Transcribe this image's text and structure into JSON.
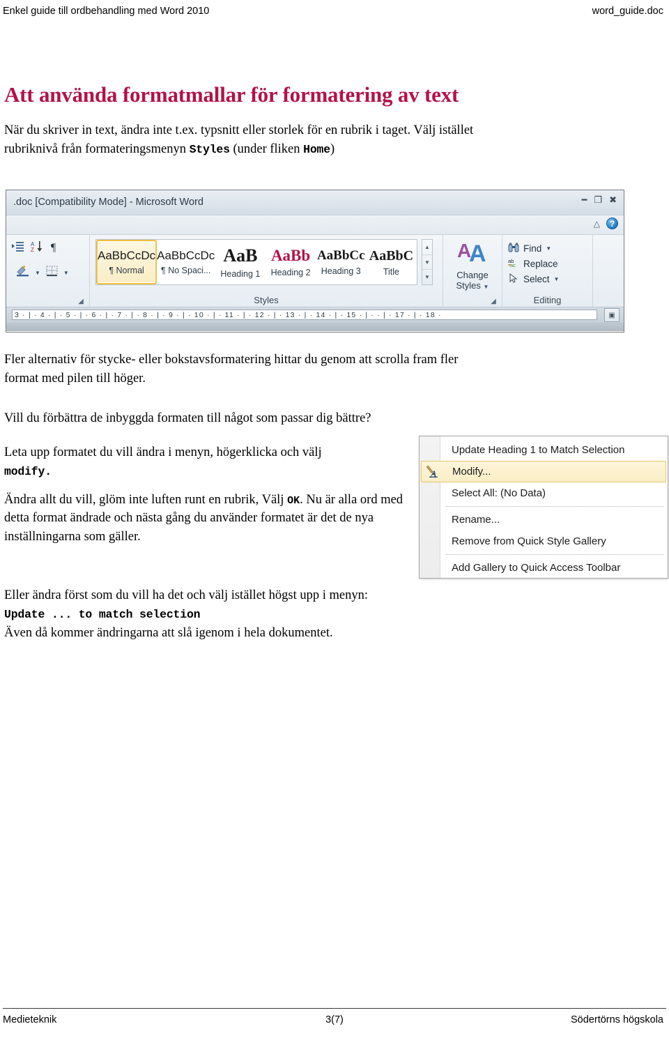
{
  "header": {
    "left": "Enkel guide till ordbehandling med Word 2010",
    "right": "word_guide.doc"
  },
  "main": {
    "title": "Att använda formatmallar för formatering av text",
    "intro_line1": "När du skriver in text, ändra inte t.ex. typsnitt eller storlek för en rubrik i taget. Välj istället",
    "intro_line2_a": "rubriknivå från formateringsmenyn ",
    "intro_line2_code": "Styles",
    "intro_line2_b": " (under fliken ",
    "intro_line2_code2": "Home",
    "intro_line2_c": ")",
    "para_scroll": "Fler alternativ för stycke- eller bokstavsformatering hittar du genom att scrolla fram fler format med pilen till höger.",
    "para_improve": "Vill du förbättra de inbyggda formaten till något som passar dig bättre?",
    "para_find_a": "Leta upp formatet du vill ändra i menyn, högerklicka och välj",
    "para_find_code": "modify.",
    "para_change_a": "Ändra allt du vill, glöm inte luften runt en rubrik, Välj ",
    "para_change_code": "OK",
    "para_change_b": ". Nu är alla ord med detta format ändrade och nästa gång du använder formatet är det de nya inställningarna som gäller.",
    "para_last_line1": "Eller ändra först som du vill ha det och välj istället högst upp  i menyn:",
    "para_last_code": "Update ... to match selection",
    "para_last_line2": "Även då kommer ändringarna att slå igenom i hela dokumentet."
  },
  "word_window": {
    "titlebar": ".doc [Compatibility Mode]  -  Microsoft Word",
    "window_buttons": [
      "minimize",
      "restore",
      "close"
    ],
    "help_button": "?",
    "ribbon_collapse": "caret-up",
    "paragraph_group": {
      "icons": [
        "increase-indent-icon",
        "sort-icon",
        "show-formatting-marks-icon",
        "shading-icon",
        "borders-icon"
      ],
      "launcher": "dialog-launcher"
    },
    "styles_group": {
      "caption": "Styles",
      "items": [
        {
          "sample": "AaBbCcDc",
          "label": "¶ Normal",
          "selected": true
        },
        {
          "sample": "AaBbCcDc",
          "label": "¶ No Spaci...",
          "selected": false
        },
        {
          "sample": "AaB",
          "label": "Heading 1",
          "selected": false
        },
        {
          "sample": "AaBb",
          "label": "Heading 2",
          "selected": false
        },
        {
          "sample": "AaBbCc",
          "label": "Heading 3",
          "selected": false
        },
        {
          "sample": "AaBbC",
          "label": "Title",
          "selected": false
        }
      ],
      "scroll_buttons": [
        "scroll-up",
        "scroll-down",
        "more-styles"
      ],
      "change_styles_label_line1": "Change",
      "change_styles_label_line2": "Styles",
      "launcher": "dialog-launcher"
    },
    "editing_group": {
      "caption": "Editing",
      "items": [
        {
          "label": "Find",
          "icon": "binoculars-icon",
          "dropdown": true
        },
        {
          "label": "Replace",
          "icon": "replace-icon",
          "dropdown": false
        },
        {
          "label": "Select",
          "icon": "cursor-icon",
          "dropdown": true
        }
      ]
    },
    "ruler": "3  ·   |   ·  4  ·   |   ·  5  ·   |   ·  6  ·   |   ·  7  ·   |   ·  8  ·   |   ·  9  ·   |   · 10 ·   |   · 11 ·   |   · 12 ·   |   · 13 ·   |   · 14 ·   |   · 15 ·   |   ·       ·   |  · 17 ·   |   · 18 ·",
    "ruler_button": "show-hide-whitespace"
  },
  "context_menu": {
    "items": [
      {
        "label": "Update Heading 1 to Match Selection",
        "mnemonic": "U",
        "selected": false,
        "icon": null,
        "separator_after": false
      },
      {
        "label": "Modify...",
        "mnemonic": "M",
        "selected": true,
        "icon": "modify-style-icon",
        "separator_after": false
      },
      {
        "label": "Select All: (No Data)",
        "mnemonic": "S",
        "selected": false,
        "icon": null,
        "separator_after": true
      },
      {
        "label": "Rename...",
        "mnemonic": "n",
        "selected": false,
        "icon": null,
        "separator_after": false
      },
      {
        "label": "Remove from Quick Style Gallery",
        "mnemonic": "Q",
        "selected": false,
        "icon": null,
        "separator_after": true
      },
      {
        "label": "Add Gallery to Quick Access Toolbar",
        "mnemonic": "A",
        "selected": false,
        "icon": null,
        "separator_after": false
      }
    ]
  },
  "footer": {
    "left": "Medieteknik",
    "center": "3(7)",
    "right": "Södertörns högskola"
  },
  "colors": {
    "title": "#B31347",
    "heading2": "#B31347",
    "selection_gold": "#F0C040"
  }
}
